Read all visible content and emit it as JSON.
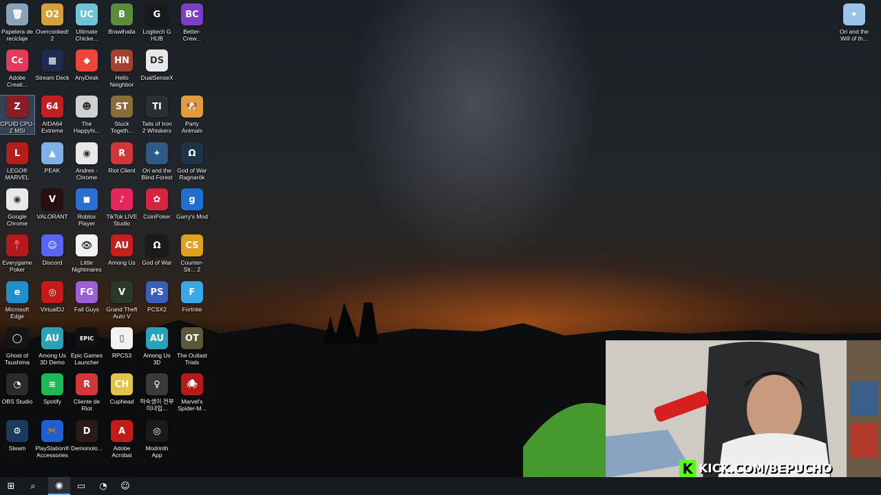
{
  "desktop": {
    "icons": [
      {
        "label": "Papelera de reciclaje",
        "color": "#8aa2b8",
        "glyph": "🗑",
        "icon": "recycle-bin-icon"
      },
      {
        "label": "Overcooked! 2",
        "color": "#d6a13a",
        "glyph": "O2",
        "icon": "overcooked-icon"
      },
      {
        "label": "Ultimate Chicke...",
        "color": "#6fc3d8",
        "glyph": "UC",
        "icon": "ultimate-chicken-horse-icon"
      },
      {
        "label": "Brawlhalla",
        "color": "#5b8b3c",
        "glyph": "B",
        "icon": "brawlhalla-icon"
      },
      {
        "label": "Logitech G HUB",
        "color": "#1a1a1a",
        "glyph": "G",
        "icon": "logitech-g-icon"
      },
      {
        "label": "Better-Crew...",
        "color": "#7a3fc4",
        "glyph": "BC",
        "icon": "better-crewlink-icon"
      },
      {
        "label": "Adobe Creati...",
        "color": "#e23b5a",
        "glyph": "Cc",
        "icon": "adobe-creative-cloud-icon"
      },
      {
        "label": "Stream Deck",
        "color": "#1e2a50",
        "glyph": "▦",
        "icon": "stream-deck-icon"
      },
      {
        "label": "AnyDesk",
        "color": "#ef443b",
        "glyph": "◆",
        "icon": "anydesk-icon"
      },
      {
        "label": "Hello Neighbor",
        "color": "#a24032",
        "glyph": "HN",
        "icon": "hello-neighbor-icon"
      },
      {
        "label": "DualSenseX",
        "color": "#e8e8e8",
        "glyph": "DS",
        "icon": "dualsensex-icon"
      },
      {
        "label": "CPUID CPU-Z MSI",
        "color": "#8a1e24",
        "glyph": "Z",
        "icon": "cpuz-icon"
      },
      {
        "label": "AIDA64 Extreme",
        "color": "#c21e24",
        "glyph": "64",
        "icon": "aida64-icon"
      },
      {
        "label": "The Happyhi...",
        "color": "#d0d0d0",
        "glyph": "☻",
        "icon": "happyhills-icon"
      },
      {
        "label": "Stuck Togeth...",
        "color": "#8c6b3a",
        "glyph": "ST",
        "icon": "stuck-together-icon"
      },
      {
        "label": "Tails of Iron 2 Whiskers o...",
        "color": "#2b2e33",
        "glyph": "TI",
        "icon": "tails-of-iron-icon"
      },
      {
        "label": "Party Animals",
        "color": "#e29c3c",
        "glyph": "🐶",
        "icon": "party-animals-icon"
      },
      {
        "label": "LEGO® MARVEL Su...",
        "color": "#b71c1c",
        "glyph": "L",
        "icon": "lego-marvel-icon"
      },
      {
        "label": "PEAK",
        "color": "#7fb0e8",
        "glyph": "▲",
        "icon": "peak-icon"
      },
      {
        "label": "Andres - Chrome",
        "color": "#e9e9e9",
        "glyph": "◉",
        "icon": "chrome-profile-icon"
      },
      {
        "label": "Riot Client",
        "color": "#d13639",
        "glyph": "R",
        "icon": "riot-client-icon"
      },
      {
        "label": "Ori and the Blind Forest",
        "color": "#2f5a86",
        "glyph": "✦",
        "icon": "ori-blind-forest-icon"
      },
      {
        "label": "God of War Ragnarök",
        "color": "#1d3348",
        "glyph": "Ω",
        "icon": "god-of-war-ragnarok-icon"
      },
      {
        "label": "Google Chrome",
        "color": "#e9e9e9",
        "glyph": "◉",
        "icon": "chrome-icon"
      },
      {
        "label": "VALORANT",
        "color": "#2a0f12",
        "glyph": "V",
        "icon": "valorant-icon"
      },
      {
        "label": "Roblox Player",
        "color": "#2a6fd6",
        "glyph": "◼",
        "icon": "roblox-icon"
      },
      {
        "label": "TikTok LIVE Studio",
        "color": "#e8255b",
        "glyph": "♪",
        "icon": "tiktok-live-icon"
      },
      {
        "label": "CoinPoker",
        "color": "#d6253f",
        "glyph": "✿",
        "icon": "coinpoker-icon"
      },
      {
        "label": "Garry's Mod",
        "color": "#1f6fd1",
        "glyph": "g",
        "icon": "garrys-mod-icon"
      },
      {
        "label": "Everygame Poker",
        "color": "#b5181d",
        "glyph": "📍",
        "icon": "everygame-poker-icon"
      },
      {
        "label": "Discord",
        "color": "#5865f2",
        "glyph": "☺",
        "icon": "discord-icon"
      },
      {
        "label": "Little Nightmares",
        "color": "#f2f2f2",
        "glyph": "👁",
        "icon": "little-nightmares-icon"
      },
      {
        "label": "Among Us",
        "color": "#c81e1e",
        "glyph": "AU",
        "icon": "among-us-icon"
      },
      {
        "label": "God of War",
        "color": "#1a1a1a",
        "glyph": "Ω",
        "icon": "god-of-war-icon"
      },
      {
        "label": "Counter-Str... 2",
        "color": "#e0a11f",
        "glyph": "CS",
        "icon": "counter-strike-icon"
      },
      {
        "label": "Microsoft Edge",
        "color": "#1f8fce",
        "glyph": "e",
        "icon": "edge-icon"
      },
      {
        "label": "VirtualDJ",
        "color": "#c41a1a",
        "glyph": "◎",
        "icon": "virtualdj-icon"
      },
      {
        "label": "Fall Guys",
        "color": "#9d5fd6",
        "glyph": "FG",
        "icon": "fall-guys-icon"
      },
      {
        "label": "Grand Theft Auto V",
        "color": "#2a3a2a",
        "glyph": "V",
        "icon": "gta-v-icon"
      },
      {
        "label": "PCSX2",
        "color": "#3b5fb8",
        "glyph": "PS",
        "icon": "pcsx2-icon"
      },
      {
        "label": "Fortnite",
        "color": "#3aa8e8",
        "glyph": "F",
        "icon": "fortnite-icon"
      },
      {
        "label": "Ghost of Tsushima V...",
        "color": "#151515",
        "glyph": "◯",
        "icon": "ghost-of-tsushima-icon"
      },
      {
        "label": "Among Us 3D Demo",
        "color": "#2aa3b8",
        "glyph": "AU",
        "icon": "among-us-3d-demo-icon"
      },
      {
        "label": "Epic Games Launcher",
        "color": "#111111",
        "glyph": "EPIC",
        "icon": "epic-games-icon"
      },
      {
        "label": "RPCS3",
        "color": "#f2f2f2",
        "glyph": "▯",
        "icon": "rpcs3-file-icon"
      },
      {
        "label": "Among Us 3D",
        "color": "#2aa3b8",
        "glyph": "AU",
        "icon": "among-us-3d-icon"
      },
      {
        "label": "The Outlast Trials",
        "color": "#5a5a3a",
        "glyph": "OT",
        "icon": "outlast-trials-icon"
      },
      {
        "label": "OBS Studio",
        "color": "#2b2b2b",
        "glyph": "◔",
        "icon": "obs-icon"
      },
      {
        "label": "Spotify",
        "color": "#1db954",
        "glyph": "≋",
        "icon": "spotify-icon"
      },
      {
        "label": "Cliente de Riot",
        "color": "#d13639",
        "glyph": "R",
        "icon": "riot-client-es-icon"
      },
      {
        "label": "Cuphead",
        "color": "#e3c34a",
        "glyph": "CH",
        "icon": "cuphead-icon"
      },
      {
        "label": "하숙생이 전부 미녀입...",
        "color": "#3a3a3a",
        "glyph": "♀",
        "icon": "korean-game-icon"
      },
      {
        "label": "Marvel's Spider-M...",
        "color": "#b51a1a",
        "glyph": "🕷",
        "icon": "spider-man-icon"
      },
      {
        "label": "Steam",
        "color": "#1b3a5c",
        "glyph": "⚙",
        "icon": "steam-icon"
      },
      {
        "label": "PlayStation® Accessories",
        "color": "#1f5fd1",
        "glyph": "🎮",
        "icon": "playstation-accessories-icon"
      },
      {
        "label": "Demonolo...",
        "color": "#2a1a1a",
        "glyph": "D",
        "icon": "demonologist-icon"
      },
      {
        "label": "Adobe Acrobat",
        "color": "#c41a1a",
        "glyph": "A",
        "icon": "adobe-acrobat-icon"
      },
      {
        "label": "Modrinth App",
        "color": "#1a1a1a",
        "glyph": "◎",
        "icon": "modrinth-icon"
      },
      {
        "label": "Ori and the Will of th...",
        "color": "#9cc4e8",
        "glyph": "✦",
        "icon": "ori-will-wisps-icon"
      }
    ]
  },
  "taskbar": {
    "items": [
      {
        "name": "start-button",
        "glyph": "⊞",
        "icon": "windows-logo-icon"
      },
      {
        "name": "search-button",
        "glyph": "⌕",
        "icon": "search-icon"
      },
      {
        "name": "taskbar-chrome",
        "glyph": "◉",
        "icon": "chrome-icon"
      },
      {
        "name": "taskbar-file-explorer",
        "glyph": "▭",
        "icon": "folder-icon"
      },
      {
        "name": "taskbar-obs",
        "glyph": "◔",
        "icon": "obs-icon"
      },
      {
        "name": "taskbar-discord",
        "glyph": "☺",
        "icon": "discord-icon"
      }
    ]
  },
  "overlay": {
    "kick_logo": "K",
    "kick_url": "KICK.COM/BEPUCHO"
  }
}
